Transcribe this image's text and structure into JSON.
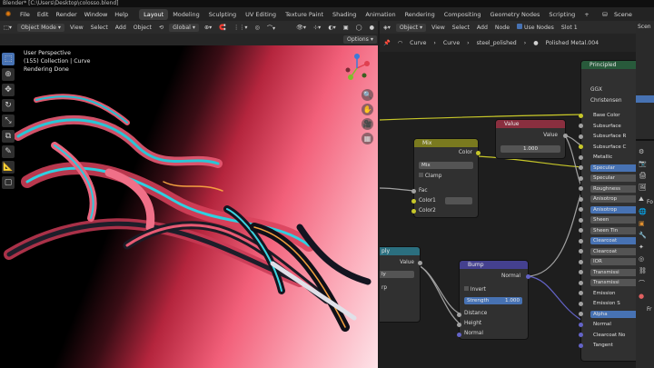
{
  "app": {
    "title": "Blender* [C:\\Users\\Desktop\\colosso.blend]"
  },
  "menu": {
    "items": [
      "File",
      "Edit",
      "Render",
      "Window",
      "Help"
    ]
  },
  "workspaces": [
    "Layout",
    "Modeling",
    "Sculpting",
    "UV Editing",
    "Texture Paint",
    "Shading",
    "Animation",
    "Rendering",
    "Compositing",
    "Geometry Nodes",
    "Scripting"
  ],
  "scene": {
    "label": "Scene"
  },
  "viewport": {
    "mode": "Object Mode",
    "menus": [
      "View",
      "Select",
      "Add",
      "Object"
    ],
    "transform_orientation": "Global",
    "options_label": "Options",
    "overlay_lines": [
      "User Perspective",
      "(155) Collection | Curve",
      "Rendering Done"
    ]
  },
  "node_editor": {
    "header": {
      "object_label": "Object",
      "menus": [
        "View",
        "Select",
        "Add",
        "Node"
      ],
      "use_nodes_label": "Use Nodes",
      "slot_label": "Slot 1"
    },
    "breadcrumb": [
      "Curve",
      "Curve",
      "steel_polished",
      "Polished Metal.004"
    ],
    "nodes": {
      "mix": {
        "title": "Mix",
        "output": "Color",
        "blend_mode": "Mix",
        "clamp": "Clamp",
        "inputs": [
          "Fac",
          "Color1",
          "Color2"
        ]
      },
      "value": {
        "title": "Value",
        "output": "Value",
        "value": "1.000"
      },
      "bump": {
        "title": "Bump",
        "output": "Normal",
        "invert": "Invert",
        "strength_label": "Strength",
        "strength_value": "1.000",
        "inputs": [
          "Distance",
          "Height",
          "Normal"
        ]
      },
      "partial": {
        "title_fragment": "ply",
        "output": "Value",
        "field_fragment": "ly",
        "field2_fragment": "rp"
      },
      "principled": {
        "title": "Principled",
        "distribution": "GGX",
        "subsurface_method": "Christensen",
        "outputs": [
          "Base Color",
          "Subsurface",
          "Subsurface R",
          "Subsurface C",
          "Metallic",
          "Specular",
          "Specular",
          "Roughness",
          "Anisotrop",
          "Anisotrop",
          "Sheen",
          "Sheen Tin",
          "Clearcoat",
          "Clearcoat",
          "IOR",
          "Transmissi",
          "Transmissi",
          "Emission",
          "Emission S",
          "Alpha",
          "Normal",
          "Clearcoat No",
          "Tangent"
        ]
      }
    }
  },
  "right_panel": {
    "labels": [
      "Scen",
      "Fo",
      "Fr"
    ]
  },
  "colors": {
    "accent": "#4772b3",
    "mix_header": "#7a7a1f",
    "value_header": "#8a2f3f",
    "bump_header": "#44408f",
    "partial_header": "#2b6f7f",
    "principled_header": "#285a3b"
  },
  "icons": [
    "cursor-icon",
    "move-icon",
    "rotate-icon",
    "scale-icon",
    "transform-icon",
    "annotate-icon",
    "measure-icon",
    "add-cube-icon",
    "axis-gizmo-icon",
    "zoom-icon",
    "hand-pan-icon",
    "camera-icon",
    "grid-icon"
  ]
}
